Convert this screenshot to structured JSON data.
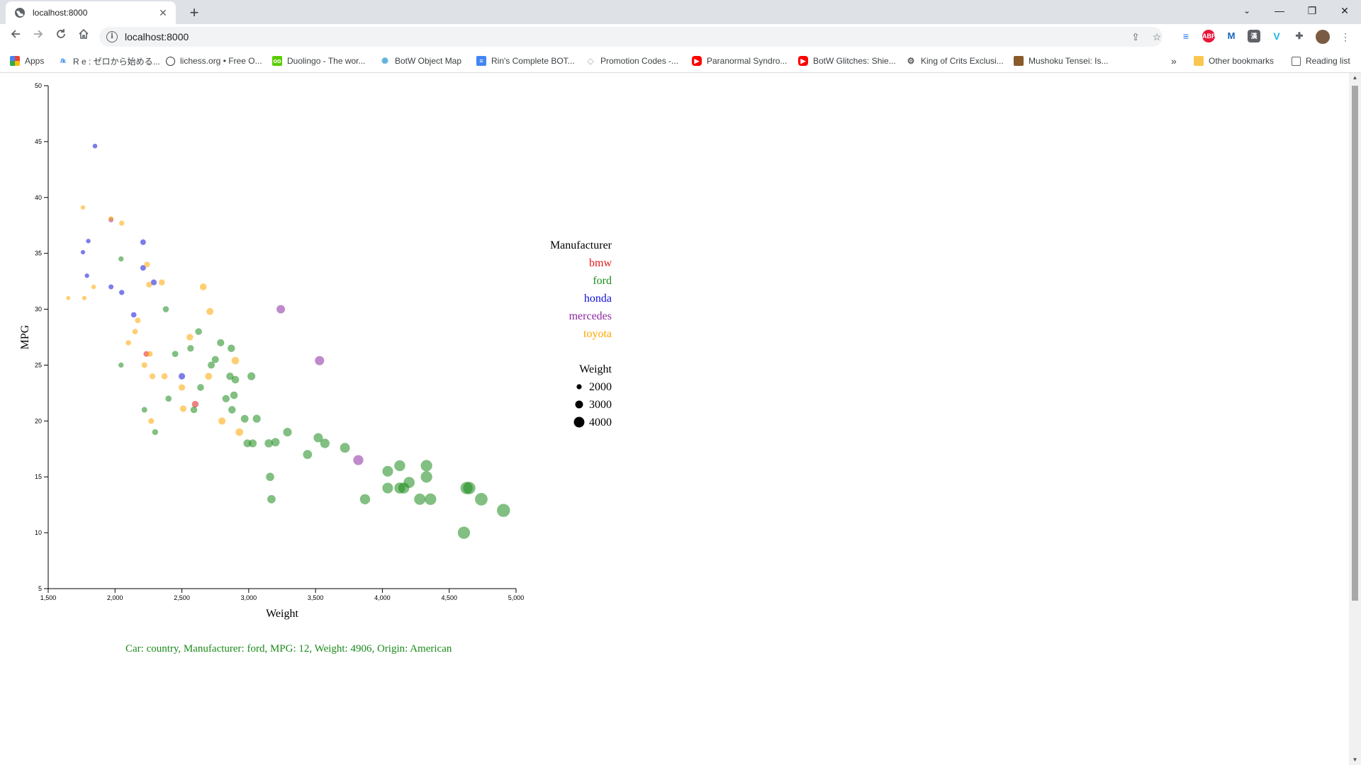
{
  "browser": {
    "tab_title": "localhost:8000",
    "url": "localhost:8000",
    "bookmarks": [
      {
        "label": "Apps",
        "icon": "apps-grid-icon",
        "color": "#4285f4"
      },
      {
        "label": "R e : ゼロから始める...",
        "icon": "syosetu-icon",
        "color": "#1a73e8"
      },
      {
        "label": "lichess.org • Free O...",
        "icon": "lichess-icon",
        "color": "#333333"
      },
      {
        "label": "Duolingo - The wor...",
        "icon": "duolingo-icon",
        "color": "#58cc02"
      },
      {
        "label": "BotW Object Map",
        "icon": "botw-map-icon",
        "color": "#5fb4d9"
      },
      {
        "label": "Rin's Complete BOT...",
        "icon": "docs-icon",
        "color": "#4285f4"
      },
      {
        "label": "Promotion Codes -...",
        "icon": "diamond-icon",
        "color": "#cccccc"
      },
      {
        "label": "Paranormal Syndro...",
        "icon": "youtube-icon",
        "color": "#ff0000"
      },
      {
        "label": "BotW Glitches: Shie...",
        "icon": "youtube-icon",
        "color": "#ff0000"
      },
      {
        "label": "King of Crits Exclusi...",
        "icon": "crits-icon",
        "color": "#555555"
      },
      {
        "label": "Mushoku Tensei: Is...",
        "icon": "mushoku-icon",
        "color": "#8a5a2b"
      }
    ],
    "overflow": "»",
    "other_bookmarks": "Other bookmarks",
    "reading_list": "Reading list"
  },
  "chart_data": {
    "type": "scatter",
    "xlabel": "Weight",
    "ylabel": "MPG",
    "xlim": [
      1500,
      5000
    ],
    "ylim": [
      5,
      50
    ],
    "xticks": [
      "1,500",
      "2,000",
      "2,500",
      "3,000",
      "3,500",
      "4,000",
      "4,500",
      "5,000"
    ],
    "yticks": [
      "5",
      "10",
      "15",
      "20",
      "25",
      "30",
      "35",
      "40",
      "45",
      "50"
    ],
    "grid": false,
    "size_encodes": "Weight",
    "colors": {
      "bmw": "#e41a1c",
      "ford": "#1b8a1b",
      "honda": "#1010d8",
      "mercedes": "#8b2aa0",
      "toyota": "#ffa500"
    },
    "legend": {
      "title": "Manufacturer",
      "items": [
        "bmw",
        "ford",
        "honda",
        "mercedes",
        "toyota"
      ],
      "size_title": "Weight",
      "size_items": [
        "2000",
        "3000",
        "4000"
      ],
      "placement": "right"
    },
    "series": [
      {
        "name": "bmw",
        "points": [
          [
            2234,
            26
          ],
          [
            2600,
            21.5
          ]
        ]
      },
      {
        "name": "ford",
        "points": [
          [
            2045,
            34.5
          ],
          [
            2045,
            25
          ],
          [
            2220,
            21
          ],
          [
            2300,
            19
          ],
          [
            2380,
            30
          ],
          [
            2400,
            22
          ],
          [
            2450,
            26
          ],
          [
            2565,
            26.5
          ],
          [
            2590,
            21
          ],
          [
            2625,
            28
          ],
          [
            2640,
            23
          ],
          [
            2720,
            25
          ],
          [
            2750,
            25.5
          ],
          [
            2790,
            27
          ],
          [
            2830,
            22
          ],
          [
            2860,
            24
          ],
          [
            2870,
            26.5
          ],
          [
            2875,
            21
          ],
          [
            2890,
            22.3
          ],
          [
            2900,
            23.7
          ],
          [
            2970,
            20.2
          ],
          [
            2990,
            18
          ],
          [
            3020,
            24
          ],
          [
            3030,
            18
          ],
          [
            3060,
            20.2
          ],
          [
            3150,
            18
          ],
          [
            3160,
            15
          ],
          [
            3170,
            13
          ],
          [
            3200,
            18.1
          ],
          [
            3290,
            19
          ],
          [
            3440,
            17
          ],
          [
            3520,
            18.5
          ],
          [
            3570,
            18
          ],
          [
            3720,
            17.6
          ],
          [
            3870,
            13
          ],
          [
            4040,
            15.5
          ],
          [
            4040,
            14
          ],
          [
            4130,
            16
          ],
          [
            4130,
            14
          ],
          [
            4160,
            14
          ],
          [
            4200,
            14.5
          ],
          [
            4280,
            13
          ],
          [
            4330,
            16
          ],
          [
            4330,
            15
          ],
          [
            4360,
            13
          ],
          [
            4610,
            10
          ],
          [
            4630,
            14
          ],
          [
            4650,
            14
          ],
          [
            4740,
            13
          ],
          [
            4906,
            12
          ]
        ]
      },
      {
        "name": "honda",
        "points": [
          [
            1850,
            44.6
          ],
          [
            1760,
            35.1
          ],
          [
            1800,
            36.1
          ],
          [
            1790,
            33
          ],
          [
            1970,
            32
          ],
          [
            2050,
            31.5
          ],
          [
            2140,
            29.5
          ],
          [
            2210,
            36
          ],
          [
            2210,
            33.7
          ],
          [
            2290,
            32.4
          ],
          [
            2500,
            24
          ]
        ]
      },
      {
        "name": "mercedes",
        "points": [
          [
            1970,
            38
          ],
          [
            3240,
            30
          ],
          [
            3530,
            25.4
          ],
          [
            3820,
            16.5
          ]
        ]
      },
      {
        "name": "toyota",
        "points": [
          [
            1650,
            31
          ],
          [
            1760,
            39.1
          ],
          [
            1770,
            31
          ],
          [
            1840,
            32
          ],
          [
            1970,
            38.1
          ],
          [
            2050,
            37.7
          ],
          [
            2100,
            27
          ],
          [
            2150,
            28
          ],
          [
            2170,
            29
          ],
          [
            2220,
            25
          ],
          [
            2240,
            34
          ],
          [
            2255,
            32.2
          ],
          [
            2260,
            26
          ],
          [
            2270,
            20
          ],
          [
            2280,
            24
          ],
          [
            2350,
            32.4
          ],
          [
            2370,
            24
          ],
          [
            2500,
            23
          ],
          [
            2510,
            21.1
          ],
          [
            2560,
            27.5
          ],
          [
            2660,
            32
          ],
          [
            2700,
            24
          ],
          [
            2710,
            29.8
          ],
          [
            2800,
            20
          ],
          [
            2900,
            25.4
          ],
          [
            2930,
            19
          ]
        ]
      }
    ]
  },
  "tooltip": {
    "text": "Car: country, Manufacturer: ford, MPG: 12, Weight: 4906, Origin: American",
    "color": "#1b8a1b"
  }
}
